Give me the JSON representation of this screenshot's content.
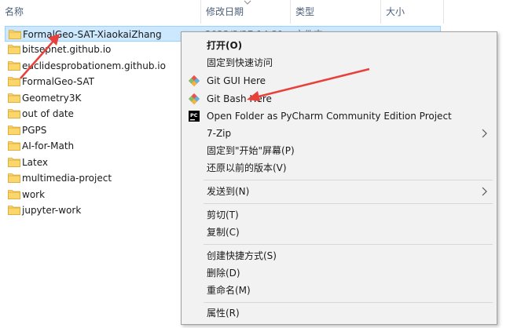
{
  "columns": {
    "name": "名称",
    "date": "修改日期",
    "type": "类型",
    "size": "大小"
  },
  "files": [
    {
      "name": "FormalGeo-SAT-XiaokaiZhang",
      "date": "2023/3/27 14:21",
      "type": "文件夹",
      "selected": true
    },
    {
      "name": "bitsepnet.github.io",
      "selected": false
    },
    {
      "name": "euclidesprobationem.github.io",
      "selected": false
    },
    {
      "name": "FormalGeo-SAT",
      "selected": false
    },
    {
      "name": "Geometry3K",
      "selected": false
    },
    {
      "name": "out of date",
      "selected": false
    },
    {
      "name": "PGPS",
      "selected": false
    },
    {
      "name": "AI-for-Math",
      "selected": false
    },
    {
      "name": "Latex",
      "selected": false
    },
    {
      "name": "multimedia-project",
      "selected": false
    },
    {
      "name": "work",
      "selected": false
    },
    {
      "name": "jupyter-work",
      "selected": false
    }
  ],
  "menu": {
    "open": "打开(O)",
    "pin_quick": "固定到快速访问",
    "git_gui": "Git GUI Here",
    "git_bash": "Git Bash Here",
    "pycharm": "Open Folder as PyCharm Community Edition Project",
    "zip": "7-Zip",
    "pin_start": "固定到\"开始\"屏幕(P)",
    "restore": "还原以前的版本(V)",
    "send_to": "发送到(N)",
    "cut": "剪切(T)",
    "copy": "复制(C)",
    "shortcut": "创建快捷方式(S)",
    "delete": "删除(D)",
    "rename": "重命名(M)",
    "properties": "属性(R)"
  },
  "icons": {
    "folder": "folder-icon",
    "git": "git-icon",
    "pycharm": "pycharm-icon",
    "submenu": "chevron-right-icon"
  },
  "colors": {
    "selection": "#cce8ff",
    "annotation": "#e8403a",
    "folder": "#f8d775"
  }
}
